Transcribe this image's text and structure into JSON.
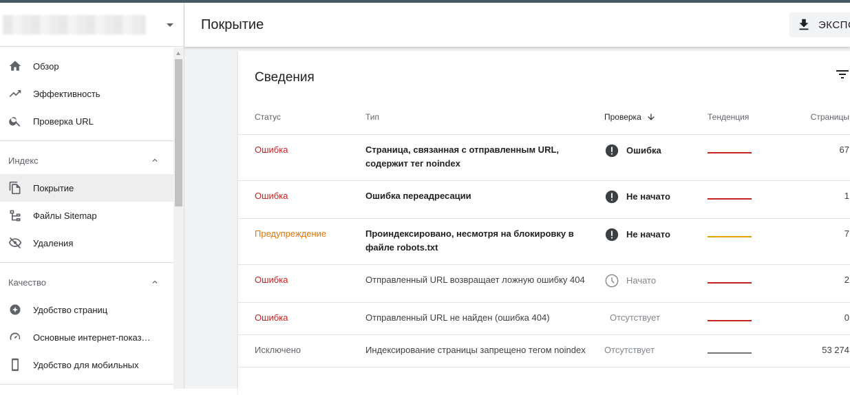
{
  "header": {
    "title": "Покрытие",
    "export_label": "ЭКСПО"
  },
  "sidebar": {
    "top_items": [
      {
        "label": "Обзор",
        "icon": "home-icon"
      },
      {
        "label": "Эффективность",
        "icon": "trending-up-icon"
      },
      {
        "label": "Проверка URL",
        "icon": "search-icon"
      }
    ],
    "index_section": {
      "title": "Индекс",
      "items": [
        {
          "label": "Покрытие",
          "icon": "copy-pages-icon",
          "active": true
        },
        {
          "label": "Файлы Sitemap",
          "icon": "sitemap-icon"
        },
        {
          "label": "Удаления",
          "icon": "eye-off-icon"
        }
      ]
    },
    "quality_section": {
      "title": "Качество",
      "items": [
        {
          "label": "Удобство страниц",
          "icon": "plus-circle-icon"
        },
        {
          "label": "Основные интернет-показ…",
          "icon": "gauge-icon"
        },
        {
          "label": "Удобство для мобильных",
          "icon": "smartphone-icon"
        }
      ]
    }
  },
  "details": {
    "title": "Сведения",
    "columns": {
      "status": "Статус",
      "type": "Тип",
      "validation": "Проверка",
      "trend": "Тенденция",
      "pages": "Страницы"
    },
    "rows": [
      {
        "status": "Ошибка",
        "status_kind": "error",
        "type": "Страница, связанная с отправленным URL, содержит тег noindex",
        "type_bold": true,
        "validation": "Ошибка",
        "validation_icon": "alert-circle-icon",
        "trend_color": "#c5221f",
        "pages": "67"
      },
      {
        "status": "Ошибка",
        "status_kind": "error",
        "type": "Ошибка переадресации",
        "type_bold": true,
        "validation": "Не начато",
        "validation_icon": "alert-circle-icon",
        "trend_color": "#c5221f",
        "pages": "1"
      },
      {
        "status": "Предупреждение",
        "status_kind": "warning",
        "type": "Проиндексировано, несмотря на блокировку в файле robots.txt",
        "type_bold": true,
        "validation": "Не начато",
        "validation_icon": "alert-circle-icon",
        "trend_color": "#e8a000",
        "pages": "7"
      },
      {
        "status": "Ошибка",
        "status_kind": "error",
        "type": "Отправленный URL возвращает ложную ошибку 404",
        "type_bold": false,
        "validation": "Начато",
        "validation_icon": "clock-icon",
        "trend_color": "#c5221f",
        "pages": "2"
      },
      {
        "status": "Ошибка",
        "status_kind": "error",
        "type": "Отправленный URL не найден (ошибка 404)",
        "type_bold": false,
        "validation": "Отсутствует",
        "validation_icon": "",
        "trend_color": "#c5221f",
        "pages": "0"
      },
      {
        "status": "Исключено",
        "status_kind": "excluded",
        "type": "Индексирование страницы запрещено тегом noindex",
        "type_bold": false,
        "validation": "Отсутствует",
        "validation_icon": "",
        "trend_color": "#757575",
        "pages": "53 274"
      }
    ]
  }
}
